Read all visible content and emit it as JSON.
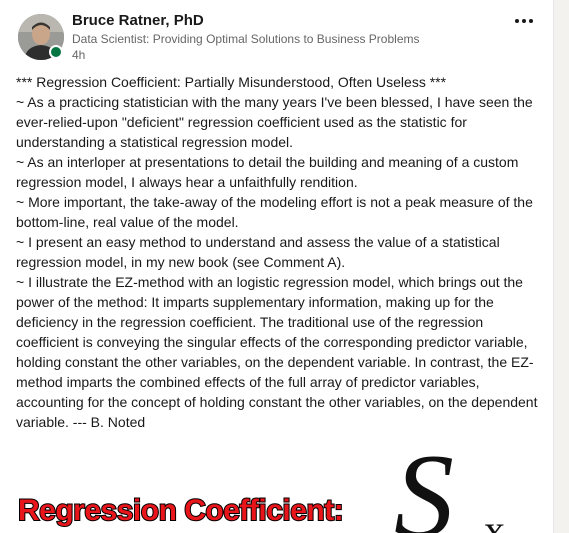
{
  "author": {
    "name": "Bruce Ratner, PhD",
    "headline": "Data Scientist: Providing Optimal Solutions to Business Problems",
    "time": "4h",
    "presence_color": "#057642"
  },
  "menu": {
    "icon": "more-horizontal-icon"
  },
  "post": {
    "paragraphs": [
      "*** Regression Coefficient: Partially Misunderstood, Often Useless ***",
      "~ As a practicing statistician with the many years I've been blessed, I have seen the ever-relied-upon \"deficient\" regression coefficient used as the statistic for understanding a statistical regression model.",
      "~ As an interloper at presentations to detail the building and meaning of a custom regression model, I always hear a unfaithfully rendition.",
      "~ More important, the take-away of the modeling effort is not a peak measure of the bottom-line, real value of the model.",
      "~ I present an easy method to understand and assess the value of a statistical regression model, in my new book (see Comment A).",
      "~ I illustrate the EZ-method with an logistic regression model, which brings out the power of the method: It imparts supplementary information, making up for the deficiency in the regression coefficient. The traditional use of the regression coefficient is conveying the singular effects of the corresponding predictor variable, holding constant the other variables, on the dependent variable. In contrast, the EZ-method imparts the combined effects of the full array of predictor variables, accounting for the concept of holding constant the other variables, on the dependent variable. --- B. Noted"
    ]
  },
  "preview": {
    "title": "Regression Coefficient:",
    "symbol": "S",
    "subscript": "x",
    "title_color": "#e8151b"
  }
}
